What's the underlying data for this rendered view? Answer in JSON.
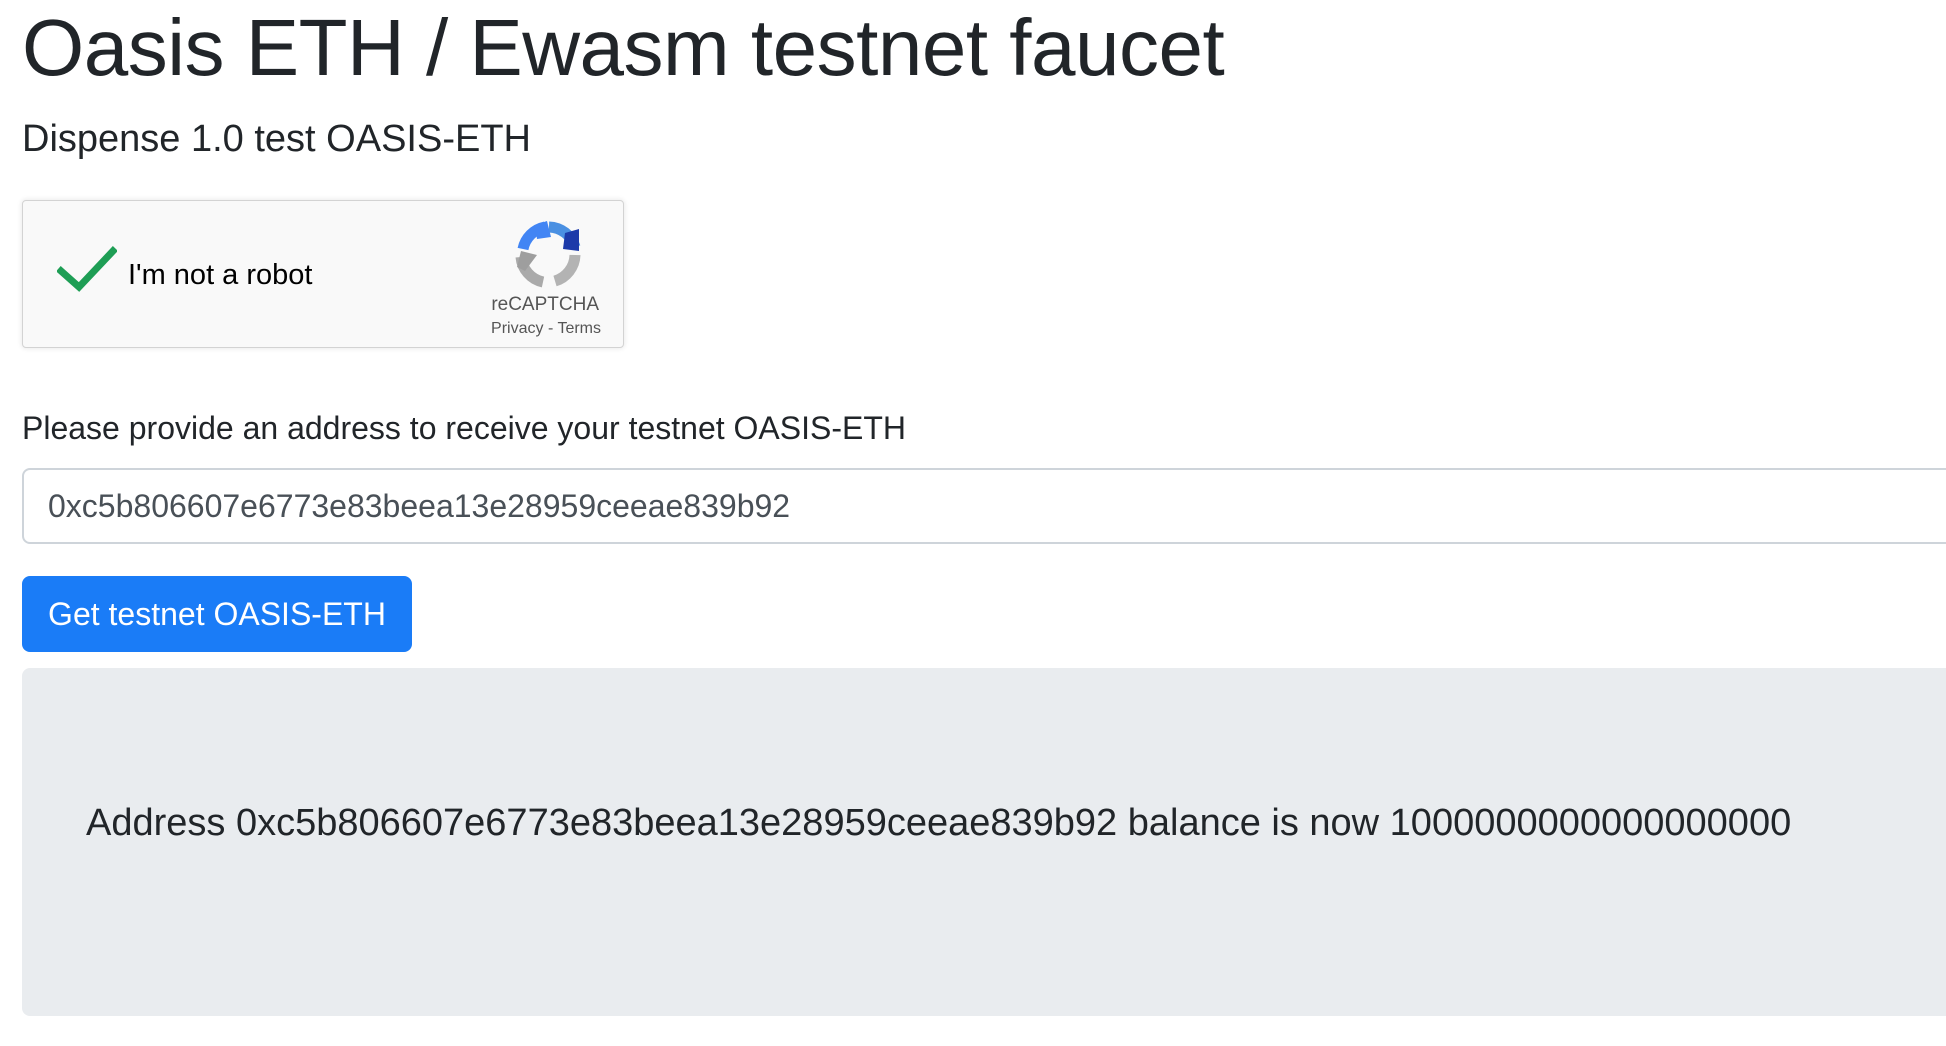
{
  "header": {
    "title": "Oasis ETH / Ewasm testnet faucet",
    "subtitle": "Dispense 1.0 test OASIS-ETH"
  },
  "recaptcha": {
    "checkbox_label": "I'm not a robot",
    "checked": true,
    "brand": "reCAPTCHA",
    "privacy_link": "Privacy",
    "separator": " - ",
    "terms_link": "Terms",
    "check_icon": "check-icon",
    "logo_icon": "recaptcha-logo-icon",
    "check_color": "#1e9e55"
  },
  "form": {
    "address_label": "Please provide an address to receive your testnet OASIS-ETH",
    "address_value": "0xc5b806607e6773e83beea13e28959ceeae839b92",
    "submit_label": "Get testnet OASIS-ETH",
    "button_color": "#1a7cf7"
  },
  "result": {
    "message": "Address 0xc5b806607e6773e83beea13e28959ceeae839b92 balance is now 1000000000000000000",
    "panel_color": "#e9ecef"
  }
}
